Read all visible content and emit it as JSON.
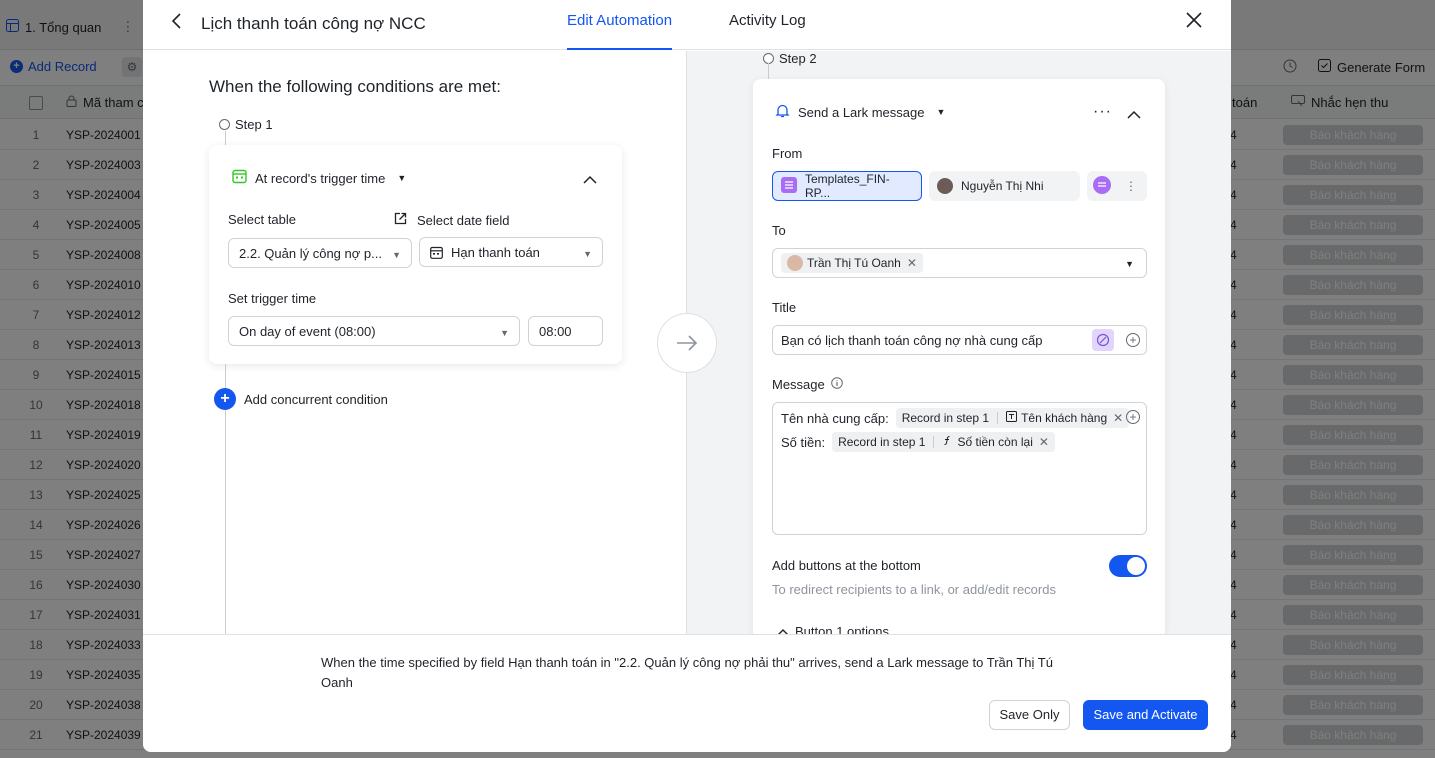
{
  "background": {
    "tab_label": "1. Tổng quan",
    "add_record": "Add Record",
    "generate_form": "Generate Form",
    "col_code": "Mã tham c",
    "col_toan": "toán",
    "col_reminder": "Nhắc hẹn thu",
    "rows": [
      {
        "n": "1",
        "code": "YSP-2024001",
        "v": "4",
        "btn": "Báo khách hàng"
      },
      {
        "n": "2",
        "code": "YSP-2024003",
        "v": "4",
        "btn": "Báo khách hàng"
      },
      {
        "n": "3",
        "code": "YSP-2024004",
        "v": "4",
        "btn": "Báo khách hàng"
      },
      {
        "n": "4",
        "code": "YSP-2024005",
        "v": "4",
        "btn": "Báo khách hàng"
      },
      {
        "n": "5",
        "code": "YSP-2024008",
        "v": "4",
        "btn": "Báo khách hàng"
      },
      {
        "n": "6",
        "code": "YSP-2024010",
        "v": "4",
        "btn": "Báo khách hàng"
      },
      {
        "n": "7",
        "code": "YSP-2024012",
        "v": "4",
        "btn": "Báo khách hàng"
      },
      {
        "n": "8",
        "code": "YSP-2024013",
        "v": "4",
        "btn": "Báo khách hàng"
      },
      {
        "n": "9",
        "code": "YSP-2024015",
        "v": "4",
        "btn": "Báo khách hàng"
      },
      {
        "n": "10",
        "code": "YSP-2024018",
        "v": "4",
        "btn": "Báo khách hàng"
      },
      {
        "n": "11",
        "code": "YSP-2024019",
        "v": "4",
        "btn": "Báo khách hàng"
      },
      {
        "n": "12",
        "code": "YSP-2024020",
        "v": "4",
        "btn": "Báo khách hàng"
      },
      {
        "n": "13",
        "code": "YSP-2024025",
        "v": "4",
        "btn": "Báo khách hàng"
      },
      {
        "n": "14",
        "code": "YSP-2024026",
        "v": "4",
        "btn": "Báo khách hàng"
      },
      {
        "n": "15",
        "code": "YSP-2024027",
        "v": "4",
        "btn": "Báo khách hàng"
      },
      {
        "n": "16",
        "code": "YSP-2024030",
        "v": "4",
        "btn": "Báo khách hàng"
      },
      {
        "n": "17",
        "code": "YSP-2024031",
        "v": "4",
        "btn": "Báo khách hàng"
      },
      {
        "n": "18",
        "code": "YSP-2024033",
        "v": "4",
        "btn": "Báo khách hàng"
      },
      {
        "n": "19",
        "code": "YSP-2024035",
        "v": "4",
        "btn": "Báo khách hàng"
      },
      {
        "n": "20",
        "code": "YSP-2024038",
        "v": "4",
        "btn": "Báo khách hàng"
      },
      {
        "n": "21",
        "code": "YSP-2024039",
        "v": "4",
        "btn": "Báo khách hàng"
      }
    ]
  },
  "modal": {
    "title": "Lịch thanh toán công nợ NCC",
    "tabs": [
      {
        "label": "Edit Automation",
        "active": true
      },
      {
        "label": "Activity Log",
        "active": false
      }
    ]
  },
  "trigger": {
    "heading": "When the following conditions are met:",
    "step_label": "Step 1",
    "type": "At record's trigger time",
    "select_table_label": "Select table",
    "select_table_value": "2.2. Quản lý công nợ p...",
    "select_date_label": "Select date field",
    "select_date_value": "Hạn thanh toán",
    "trigger_time_label": "Set trigger time",
    "trigger_time_value": "On day of event (08:00)",
    "time_value": "08:00",
    "add_condition": "Add concurrent condition"
  },
  "action": {
    "step_label": "Step 2",
    "type": "Send a Lark message",
    "from_label": "From",
    "from_template": "Templates_FIN-RP...",
    "from_user": "Nguyễn Thị Nhi",
    "to_label": "To",
    "to_recipient": "Trần Thị Tú Oanh",
    "title_label": "Title",
    "title_value": "Bạn có lịch thanh toán công nợ nhà cung cấp",
    "message_label": "Message",
    "message_line1_label": "Tên nhà cung cấp:",
    "message_line1_source": "Record in step 1",
    "message_line1_field": "Tên khách hàng",
    "message_line2_label": "Số tiền:",
    "message_line2_source": "Record in step 1",
    "message_line2_field": "Số tiền còn lại",
    "buttons_label": "Add buttons at the bottom",
    "buttons_hint": "To redirect recipients to a link, or add/edit records",
    "buttons_enabled": true,
    "button1_options": "Button 1 options"
  },
  "footer": {
    "summary": "When the time specified by field Hạn thanh toán in \"2.2. Quản lý công nợ phải thu\" arrives, send a Lark message to Trần Thị Tú Oanh",
    "save_only": "Save Only",
    "save_activate": "Save and Activate"
  },
  "colors": {
    "accent": "#1456f0",
    "green_icon": "#34c724",
    "purple_template": "#a86cf7"
  }
}
